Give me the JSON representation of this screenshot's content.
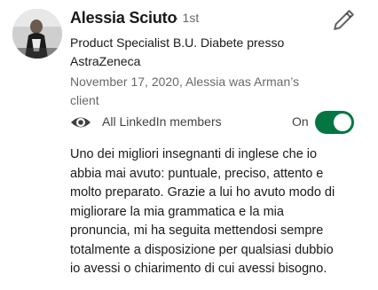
{
  "profile": {
    "name": "Alessia Sciuto",
    "degree": "· 1st",
    "headline_lines": [
      "Product Specialist B.U. Diabete presso",
      "AstraZeneca"
    ],
    "meta_lines": [
      "November 17, 2020, Alessia was Arman’s",
      "client"
    ],
    "avatar_icon": "profile-photo"
  },
  "visibility": {
    "label": "All LinkedIn members",
    "icon": "eye-icon",
    "toggle_label": "On",
    "toggle_on": true,
    "toggle_color": "#057642"
  },
  "recommendation_lines": [
    "Uno dei migliori insegnanti di inglese che io",
    "abbia mai avuto: puntuale, preciso, attento e",
    "molto preparato. Grazie a lui ho avuto modo di",
    "migliorare la mia grammatica e la mia",
    "pronuncia, mi ha seguita mettendosi sempre",
    "totalmente a disposizione per qualsiasi dubbio",
    "io avessi o chiarimento di cui avessi bisogno."
  ],
  "actions": {
    "edit_icon": "pencil-icon"
  }
}
